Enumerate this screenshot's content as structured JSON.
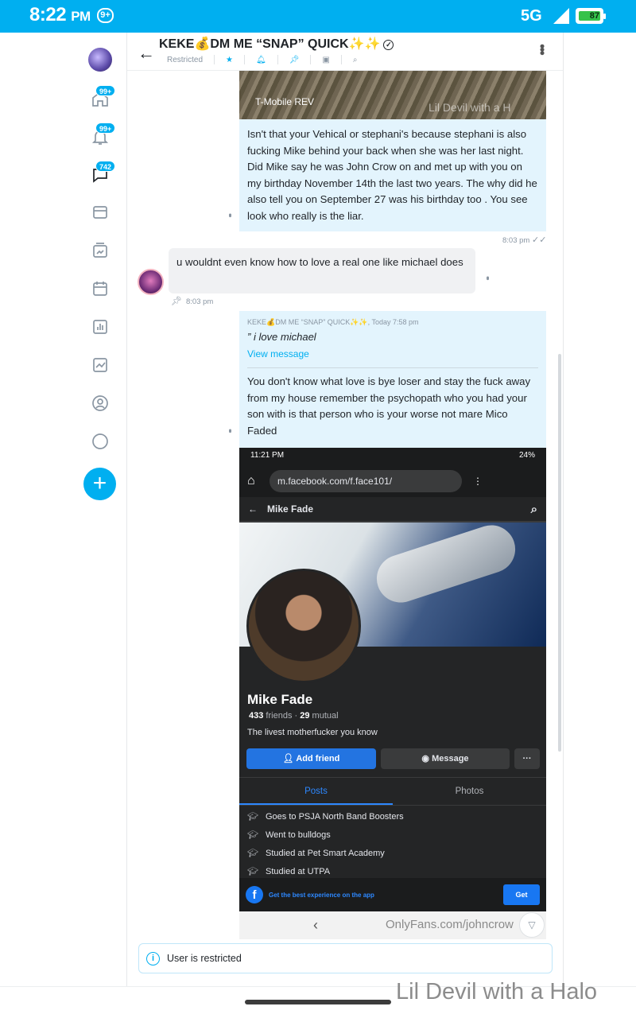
{
  "status_bar": {
    "time": "8:22",
    "ampm": "PM",
    "notification_count": "9+",
    "network": "5G",
    "battery": "87"
  },
  "sidebar": {
    "items": [
      {
        "name": "home-icon",
        "badge": "99+"
      },
      {
        "name": "bell-icon",
        "badge": "99+"
      },
      {
        "name": "messages-icon",
        "badge": "742"
      },
      {
        "name": "collections-icon",
        "badge": ""
      },
      {
        "name": "vault-icon",
        "badge": ""
      },
      {
        "name": "calendar-icon",
        "badge": ""
      },
      {
        "name": "statistics-icon",
        "badge": ""
      },
      {
        "name": "analytics-icon",
        "badge": ""
      },
      {
        "name": "profile-icon",
        "badge": ""
      },
      {
        "name": "more-icon",
        "badge": ""
      }
    ],
    "fab": "+"
  },
  "chat": {
    "title": "KEKE💰DM ME “SNAP” QUICK✨✨",
    "restricted_label": "Restricted",
    "messages": [
      {
        "direction": "out",
        "image_watermark": "T-Mobile REV",
        "image_watermark_2": "Lil Devil with a H",
        "text": "Isn't that your Vehical or stephani's because stephani is also fucking Mike behind your back when she was her last night. Did Mike say he was John Crow on and met up with you on my birthday November 14th the last two years. The why did he also tell you on September 27 was his birthday too . You see look who really is the liar.",
        "time": "8:03 pm"
      },
      {
        "direction": "in",
        "text": "u wouldnt even know how to love a real one like michael does",
        "time": "8:03 pm"
      },
      {
        "direction": "out",
        "quote_header": "KEKE💰DM ME “SNAP” QUICK✨✨, Today 7:58 pm",
        "quote_text": "” i love michael",
        "quote_link": "View message",
        "text": "You don't know what love is bye loser and stay the fuck away from my house remember the psychopath who you had your son with is that person who is your worse not mare Mico Faded"
      }
    ],
    "screenshot": {
      "status_time": "11:21 PM",
      "status_right": "24%",
      "url": "m.facebook.com/f.face101/",
      "nav_name": "Mike Fade",
      "profile_name": "Mike Fade",
      "friends_count": "433",
      "friends_label": "friends",
      "mutual_count": "29",
      "mutual_label": "mutual",
      "bio": "The livest motherfucker you know",
      "add_friend": "Add friend",
      "message": "Message",
      "more": "···",
      "tab_posts": "Posts",
      "tab_photos": "Photos",
      "intro": [
        "Goes to PSJA North Band Boosters",
        "Went to bulldogs",
        "Studied at Pet Smart Academy",
        "Studied at UTPA"
      ],
      "app_banner": "Get the best experience on the app",
      "get": "Get",
      "onlyfans_watermark": "OnlyFans.com/johncrow"
    },
    "restricted_notice": "User is restricted"
  },
  "watermark": "Lil Devil with a Halo"
}
